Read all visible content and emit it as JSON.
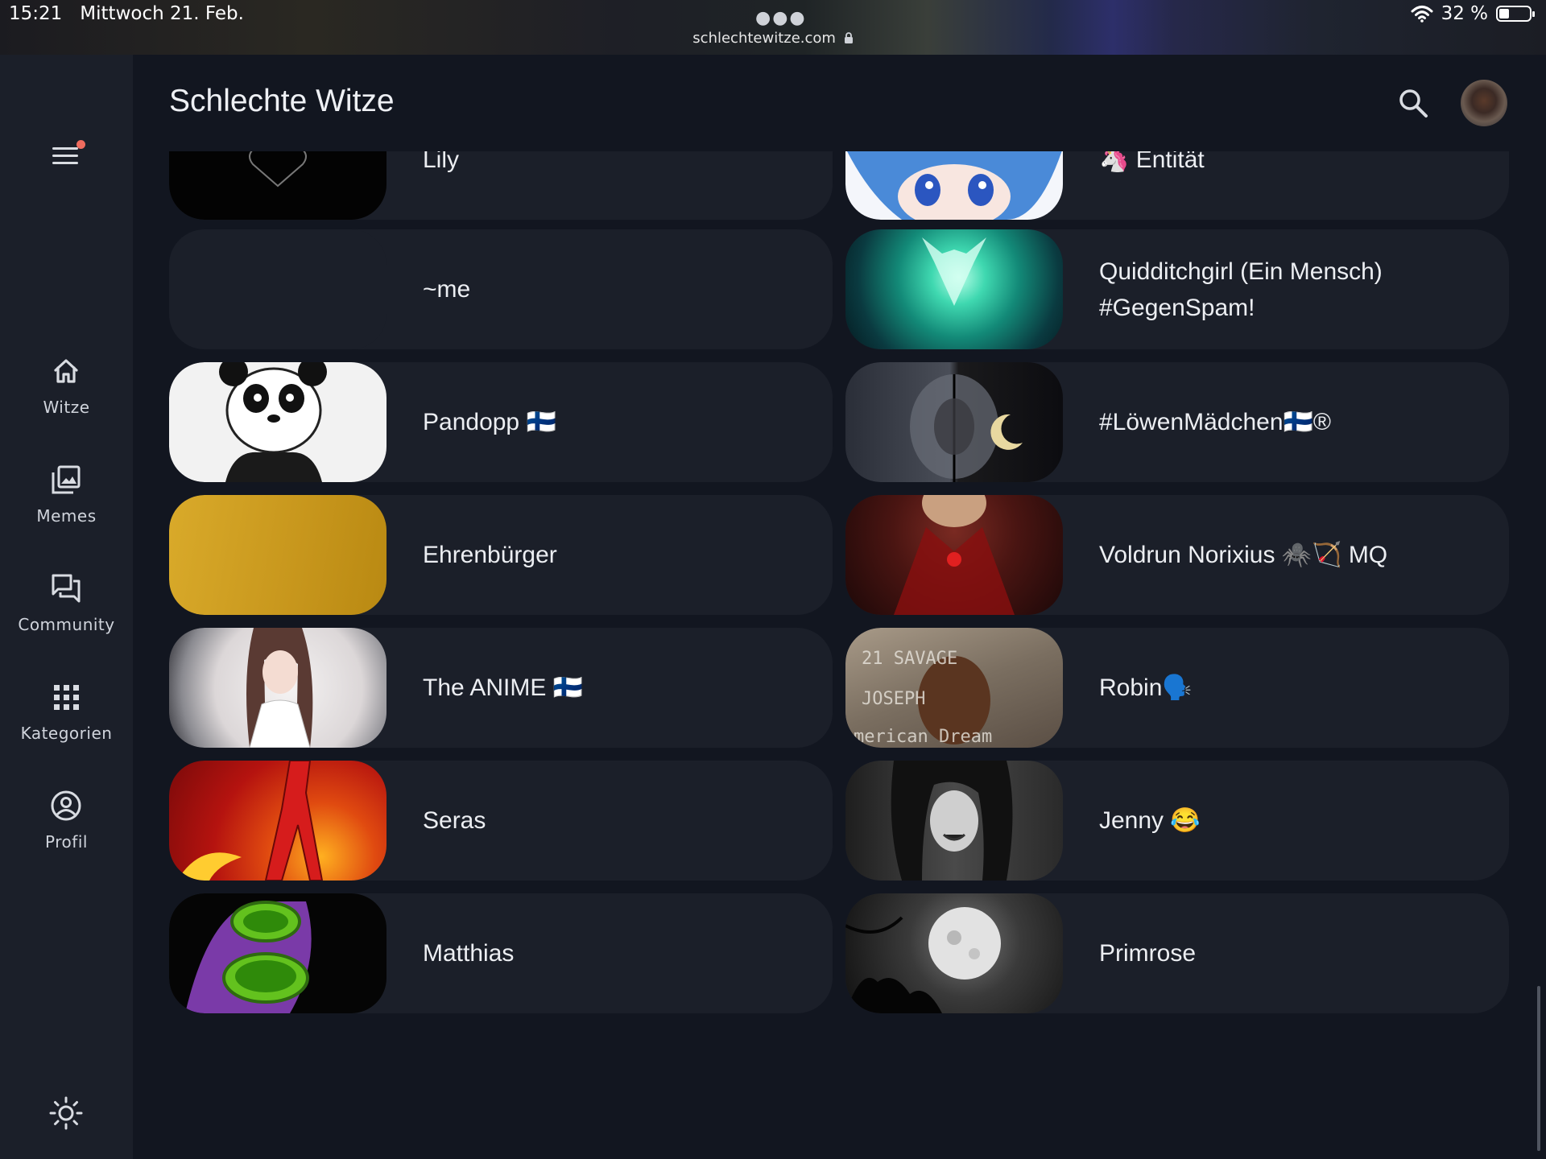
{
  "status_bar": {
    "time": "15:21",
    "date": "Mittwoch 21. Feb.",
    "url": "schlechtewitze.com",
    "battery": "32 %",
    "battery_level": 0.32
  },
  "header": {
    "title": "Schlechte Witze"
  },
  "nav": {
    "items": [
      {
        "label": "Witze",
        "icon": "home-icon"
      },
      {
        "label": "Memes",
        "icon": "image-gallery-icon"
      },
      {
        "label": "Community",
        "icon": "chat-bubbles-icon"
      },
      {
        "label": "Kategorien",
        "icon": "grid-icon"
      },
      {
        "label": "Profil",
        "icon": "account-circle-icon"
      }
    ],
    "theme_toggle_icon": "sun-icon"
  },
  "users": {
    "left": [
      {
        "name": "Lily"
      },
      {
        "name": "~me"
      },
      {
        "name": "Pandopp 🇫🇮"
      },
      {
        "name": "Ehrenbürger"
      },
      {
        "name": "The ANIME 🇫🇮"
      },
      {
        "name": "Seras"
      },
      {
        "name": "Matthias"
      }
    ],
    "right": [
      {
        "name": "🦄 Entität"
      },
      {
        "name": "Quidditchgirl (Ein Mensch) #GegenSpam!"
      },
      {
        "name": "#LöwenMädchen🇫🇮®"
      },
      {
        "name": "Voldrun Norixius 🕷️🏹 MQ"
      },
      {
        "name": "Robin🗣️"
      },
      {
        "name": "Jenny 😂"
      },
      {
        "name": "Primrose"
      }
    ]
  }
}
